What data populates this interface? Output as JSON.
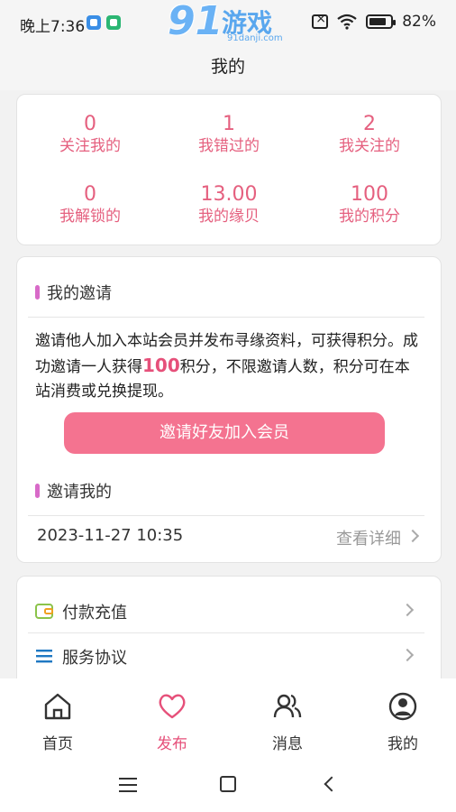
{
  "status": {
    "time": "晚上7:36",
    "battery": "82%",
    "battery_level": 0.82
  },
  "watermark": {
    "num": "91",
    "text": "游戏",
    "url": "91danji.com"
  },
  "header": {
    "title": "我的"
  },
  "stats": [
    {
      "value": "0",
      "label": "关注我的"
    },
    {
      "value": "1",
      "label": "我错过的"
    },
    {
      "value": "2",
      "label": "我关注的"
    },
    {
      "value": "0",
      "label": "我解锁的"
    },
    {
      "value": "13.00",
      "label": "我的缘贝"
    },
    {
      "value": "100",
      "label": "我的积分"
    }
  ],
  "invite": {
    "title": "我的邀请",
    "desc_before": "邀请他人加入本站会员并发布寻缘资料，可获得积分。成功邀请一人获得",
    "desc_highlight": "100",
    "desc_after": "积分，不限邀请人数，积分可在本站消费或兑换提现。",
    "button": "邀请好友加入会员",
    "invited_title": "邀请我的",
    "invited_date": "2023-11-27 10:35",
    "detail_link": "查看详细"
  },
  "menu": [
    {
      "label": "付款充值",
      "icon": "wallet-icon"
    },
    {
      "label": "服务协议",
      "icon": "list-icon"
    }
  ],
  "tabs": [
    {
      "label": "首页",
      "icon": "home-icon",
      "active": false
    },
    {
      "label": "发布",
      "icon": "heart-icon",
      "active": true
    },
    {
      "label": "消息",
      "icon": "users-icon",
      "active": false
    },
    {
      "label": "我的",
      "icon": "user-icon",
      "active": false
    }
  ],
  "colors": {
    "accent": "#e6507a",
    "button": "#f47390",
    "stat_text": "#e5607f",
    "section_bar": "#d86ac8"
  }
}
